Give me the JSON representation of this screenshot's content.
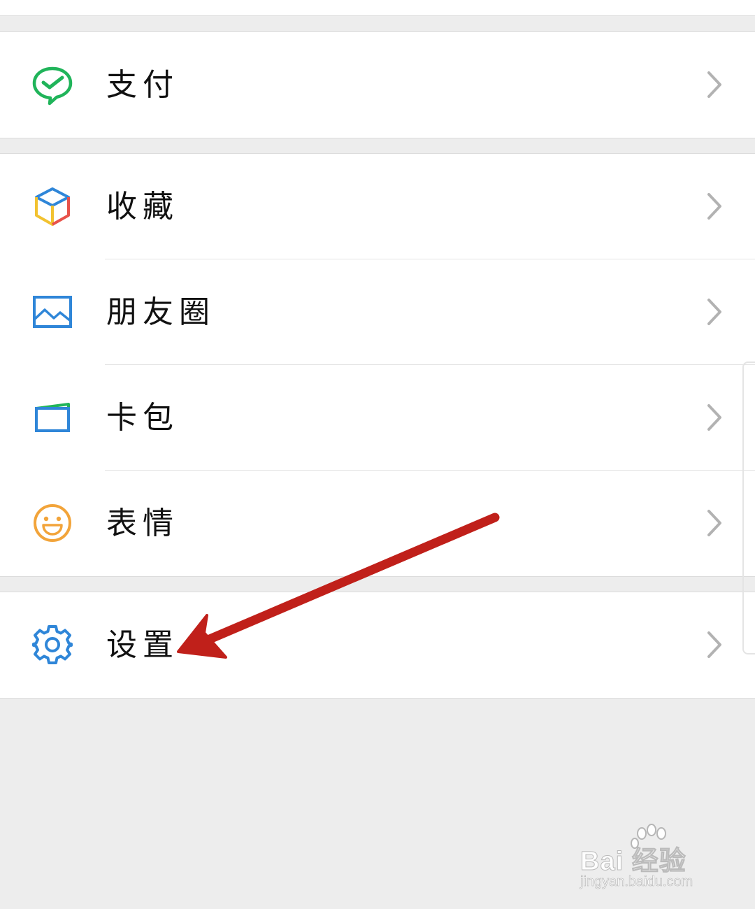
{
  "menu": {
    "groups": [
      {
        "items": [
          {
            "label": "支付",
            "icon": "wechat-pay-icon"
          }
        ]
      },
      {
        "items": [
          {
            "label": "收藏",
            "icon": "favorites-cube-icon"
          },
          {
            "label": "朋友圈",
            "icon": "moments-image-icon"
          },
          {
            "label": "卡包",
            "icon": "card-wallet-icon"
          },
          {
            "label": "表情",
            "icon": "sticker-smile-icon"
          }
        ]
      },
      {
        "items": [
          {
            "label": "设置",
            "icon": "settings-gear-icon"
          }
        ]
      }
    ],
    "chevron_icon": "chevron-right-icon"
  },
  "annotation": {
    "type": "arrow",
    "color": "#c0201a",
    "points_to": "设置"
  },
  "watermark": {
    "text": "Bai 经验",
    "url": "jingyan.baidu.com"
  },
  "colors": {
    "background": "#ededed",
    "card": "#ffffff",
    "pay_green": "#20b45a",
    "blue": "#2f86d8",
    "orange": "#f2a43a",
    "chevron": "#b2b2b2"
  }
}
